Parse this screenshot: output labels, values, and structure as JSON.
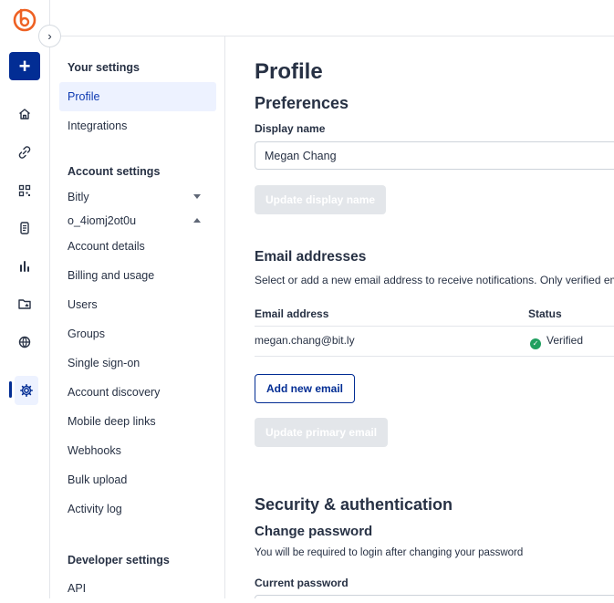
{
  "rail": {
    "create_label": "+",
    "items": [
      {
        "icon": "home-icon"
      },
      {
        "icon": "link-icon"
      },
      {
        "icon": "qr-code-icon"
      },
      {
        "icon": "pages-icon"
      },
      {
        "icon": "analytics-icon"
      },
      {
        "icon": "campaigns-icon"
      },
      {
        "icon": "custom-domains-icon"
      },
      {
        "icon": "settings-icon"
      }
    ],
    "toggle_label": "›",
    "brand_color": "#ee6123",
    "accent_color": "#022d94"
  },
  "nav": {
    "your_settings_heading": "Your settings",
    "your_settings": [
      {
        "label": "Profile"
      },
      {
        "label": "Integrations"
      }
    ],
    "account_settings_heading": "Account settings",
    "account_settings": [
      {
        "label": "Bitly"
      },
      {
        "label": "o_4iomj2ot0u"
      },
      {
        "label": "Account details"
      },
      {
        "label": "Billing and usage"
      },
      {
        "label": "Users"
      },
      {
        "label": "Groups"
      },
      {
        "label": "Single sign-on"
      },
      {
        "label": "Account discovery"
      },
      {
        "label": "Mobile deep links"
      },
      {
        "label": "Webhooks"
      },
      {
        "label": "Bulk upload"
      },
      {
        "label": "Activity log"
      }
    ],
    "developer_settings_heading": "Developer settings",
    "developer_settings": [
      {
        "label": "API"
      }
    ]
  },
  "main": {
    "title": "Profile",
    "preferences": {
      "title": "Preferences",
      "display_name_label": "Display name",
      "display_name_value": "Megan Chang",
      "update_button": "Update display name"
    },
    "emails": {
      "title": "Email addresses",
      "description": "Select or add a new email address to receive notifications. Only verified em",
      "columns": [
        "Email address",
        "Status"
      ],
      "rows": [
        {
          "email": "megan.chang@bit.ly",
          "status": "Verified"
        }
      ],
      "add_button": "Add new email",
      "update_primary_button": "Update primary email"
    },
    "security": {
      "title": "Security & authentication",
      "change_password_title": "Change password",
      "change_password_desc": "You will be required to login after changing your password",
      "current_password_label": "Current password"
    }
  }
}
